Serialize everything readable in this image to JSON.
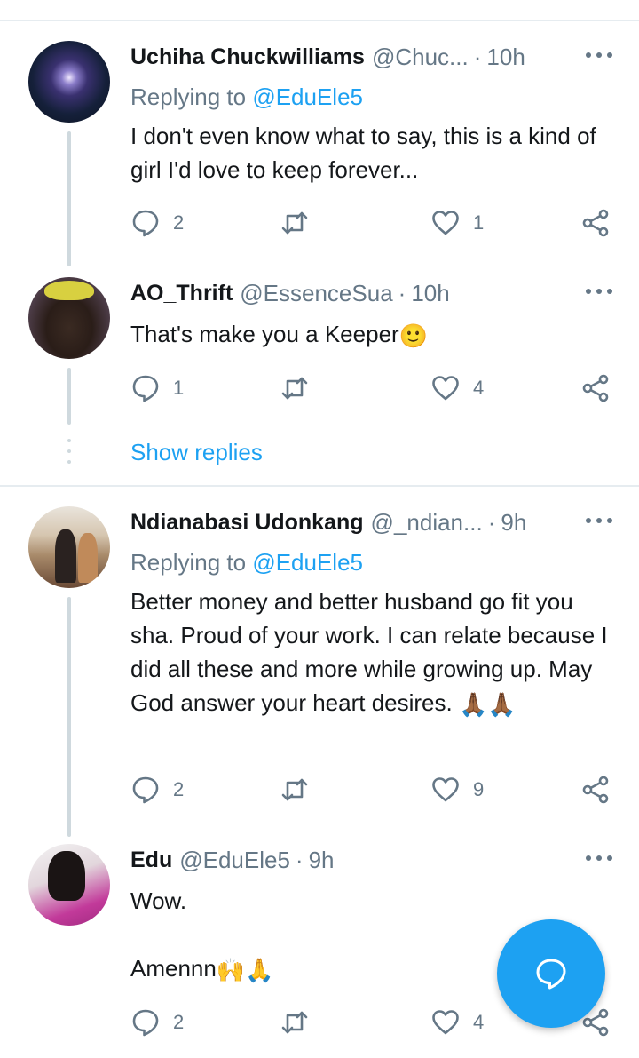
{
  "tweets": [
    {
      "name": "Uchiha Chuckwilliams",
      "handle": "@Chuc...",
      "time": "10h",
      "replying_prefix": "Replying to ",
      "replying_to": "@EduEle5",
      "text": "I don't even know what to say, this is a kind of girl I'd love to keep forever...",
      "replies": "2",
      "retweets": "",
      "likes": "1"
    },
    {
      "name": "AO_Thrift",
      "handle": "@EssenceSua",
      "time": "10h",
      "text": "That's make you a Keeper",
      "text_emoji": "🙂",
      "replies": "1",
      "retweets": "",
      "likes": "4"
    },
    {
      "name": "Ndianabasi Udonkang",
      "handle": "@_ndian...",
      "time": "9h",
      "replying_prefix": "Replying to ",
      "replying_to": "@EduEle5",
      "text": "Better money and better husband go fit you sha. Proud of your work. I can relate because I did all these and more while growing up. May God answer your heart desires.",
      "text_emoji": "🙏🏾🙏🏾",
      "replies": "2",
      "retweets": "",
      "likes": "9"
    },
    {
      "name": "Edu",
      "handle": "@EduEle5",
      "time": "9h",
      "text": "Wow.",
      "text2": "Amennn",
      "text2_emoji": "🙌🙏",
      "replies": "2",
      "retweets": "",
      "likes": "4"
    }
  ],
  "show_replies": "Show replies",
  "separator": "·",
  "colors": {
    "accent": "#1da1f2",
    "muted": "#657786",
    "text": "#14171a"
  }
}
